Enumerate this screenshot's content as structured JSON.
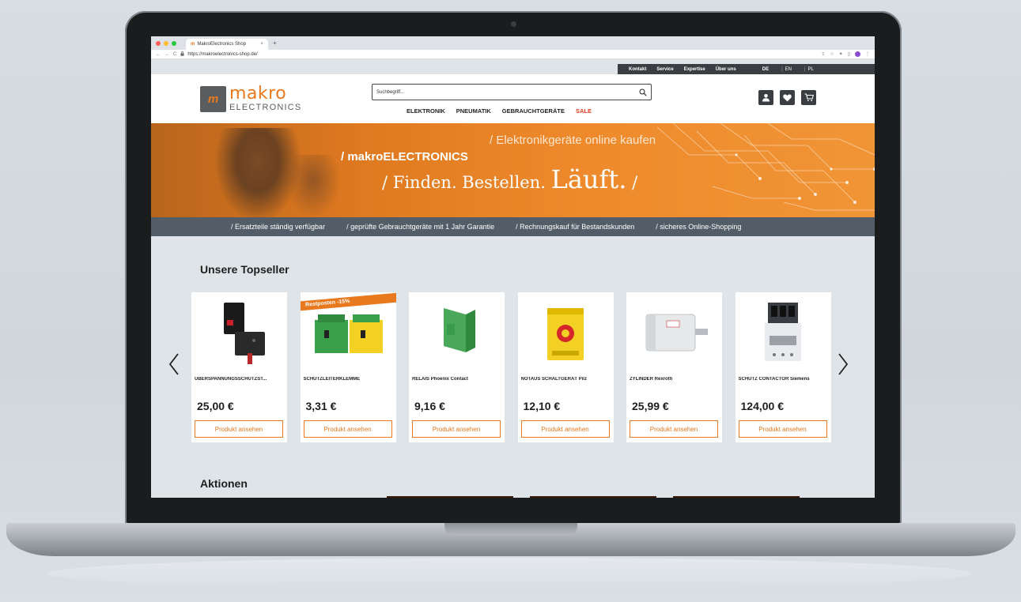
{
  "browser": {
    "tab_title": "MakroElectronics Shop",
    "tab_close": "×",
    "new_tab": "+",
    "url": "https://makroelectronics-shop.de/",
    "nav_back": "←",
    "nav_forward": "→",
    "nav_reload": "C"
  },
  "utilbar": {
    "items": [
      "Kontakt",
      "Service",
      "Expertise",
      "Über uns"
    ],
    "languages": [
      "DE",
      "EN",
      "PL"
    ],
    "lang_separator": "|"
  },
  "logo": {
    "mark": "m",
    "top": "makro",
    "bottom": "ELECTRONICS"
  },
  "search": {
    "placeholder": "Suchbegriff..."
  },
  "mainnav": [
    "ELEKTRONIK",
    "PNEUMATIK",
    "GEBRAUCHTGERÄTE",
    "SALE"
  ],
  "hero": {
    "subline": "/ Elektronikgeräte online kaufen",
    "brand": "/ makroELECTRONICS",
    "claim_prefix": "/ Finden. Bestellen.",
    "claim_big": "Läuft.",
    "claim_suffix": "/"
  },
  "usp": [
    "/ Ersatzteile ständig verfügbar",
    "/ geprüfte Gebrauchtgeräte mit 1 Jahr Garantie",
    "/ Rechnungskauf für Bestandskunden",
    "/ sicheres Online-Shopping"
  ],
  "topseller": {
    "title": "Unsere Topseller",
    "button_label": "Produkt ansehen",
    "products": [
      {
        "name": "ÜBERSPANNUNGSSCHUTZST...",
        "price": "25,00 €",
        "icon": "surge-protector-icon"
      },
      {
        "name": "SCHUTZLEITERKLEMME",
        "price": "3,31 €",
        "icon": "terminal-block-icon",
        "badge": "Restposten -15%"
      },
      {
        "name": "RELAIS Phoenix Contact",
        "price": "9,16 €",
        "icon": "relay-icon"
      },
      {
        "name": "NOTAUS SCHALTGERÄT Pilz",
        "price": "12,10 €",
        "icon": "safety-relay-icon"
      },
      {
        "name": "ZYLINDER Rexroth",
        "price": "25,99 €",
        "icon": "cylinder-icon"
      },
      {
        "name": "SCHÜTZ CONTACTOR Siemens",
        "price": "124,00 €",
        "icon": "contactor-icon"
      }
    ]
  },
  "aktionen": {
    "title": "Aktionen"
  },
  "colors": {
    "accent": "#e8791f",
    "dark": "#3a3d42",
    "usp_bar": "#535d68",
    "sale": "#e03a1e"
  }
}
